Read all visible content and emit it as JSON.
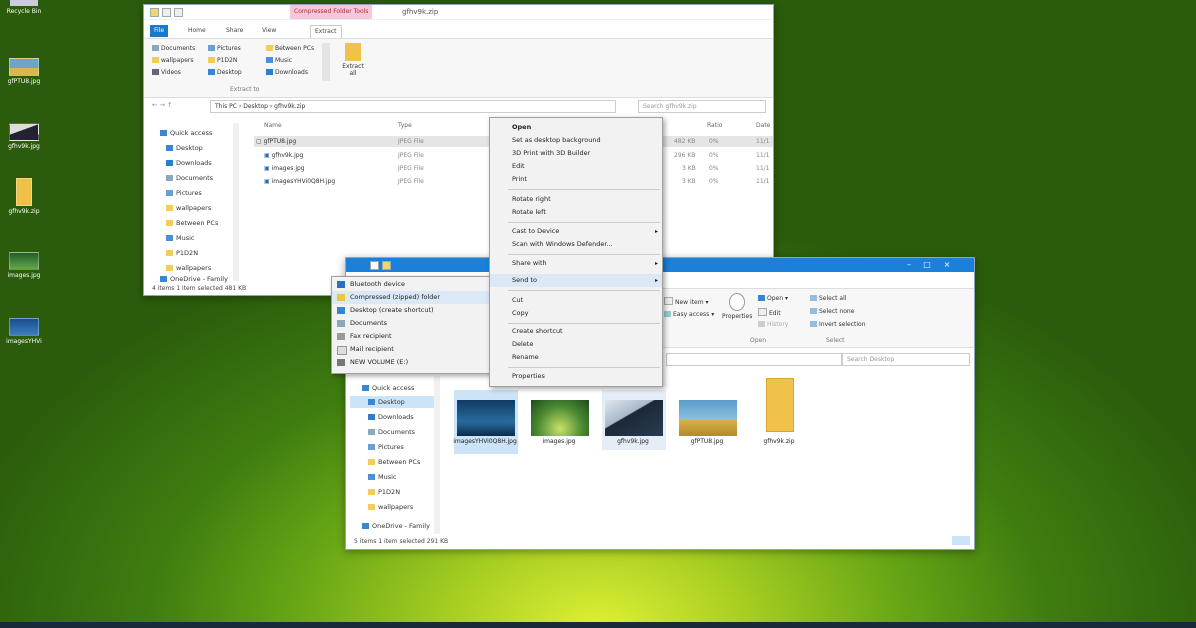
{
  "desktop": {
    "icons": [
      {
        "label": "Recycle Bin"
      },
      {
        "label": "gfPTU8.jpg"
      },
      {
        "label": "gfhv9k.jpg"
      },
      {
        "label": "gfhv9k.zip"
      },
      {
        "label": "images.jpg"
      },
      {
        "label": "imagesYHVi"
      }
    ]
  },
  "back_window": {
    "contextual_tab": "Compressed Folder Tools",
    "title": "gfhv9k.zip",
    "tabs": [
      "File",
      "Home",
      "Share",
      "View",
      "Extract"
    ],
    "ribbon": {
      "col1": [
        "Documents",
        "wallpapers",
        "Videos"
      ],
      "col2": [
        "Pictures",
        "P1D2N",
        "Desktop"
      ],
      "col3": [
        "Between PCs",
        "Music",
        "Downloads"
      ],
      "extract_all": "Extract all",
      "group_label": "Extract to"
    },
    "breadcrumb": [
      "This PC",
      "Desktop",
      "gfhv9k.zip"
    ],
    "search_placeholder": "Search gfhv9k.zip",
    "nav": [
      "Quick access",
      "Desktop",
      "Downloads",
      "Documents",
      "Pictures",
      "wallpapers",
      "Between PCs",
      "Music",
      "P1D2N",
      "wallpapers",
      "OneDrive - Family"
    ],
    "columns": [
      "Name",
      "Type",
      "Ratio",
      "Date"
    ],
    "files": [
      {
        "name": "gfPTU8.jpg",
        "type": "JPEG File",
        "size": "482 KB",
        "ratio": "0%",
        "date": "11/1"
      },
      {
        "name": "gfhv9k.jpg",
        "type": "JPEG File",
        "size": "296 KB",
        "ratio": "0%",
        "date": "11/1"
      },
      {
        "name": "images.jpg",
        "type": "JPEG File",
        "size": "3 KB",
        "ratio": "0%",
        "date": "11/1"
      },
      {
        "name": "imagesYHVi0Q8H.jpg",
        "type": "JPEG File",
        "size": "3 KB",
        "ratio": "0%",
        "date": "11/1"
      }
    ],
    "status": "4 items    1 item selected  481 KB"
  },
  "front_window": {
    "ribbon": {
      "new_item": "New item",
      "easy_access": "Easy access",
      "properties": "Properties",
      "open": "Open",
      "edit": "Edit",
      "history": "History",
      "select_all": "Select all",
      "select_none": "Select none",
      "invert_selection": "Invert selection",
      "groups": [
        "Open",
        "Select"
      ]
    },
    "search_placeholder": "Search Desktop",
    "nav": [
      "Quick access",
      "Desktop",
      "Downloads",
      "Documents",
      "Pictures",
      "Between PCs",
      "Music",
      "P1D2N",
      "wallpapers",
      "OneDrive - Family"
    ],
    "thumbs": [
      {
        "label": "imagesYHVi0Q8H.jpg"
      },
      {
        "label": "images.jpg"
      },
      {
        "label": "gfhv9k.jpg"
      },
      {
        "label": "gfPTU8.jpg"
      },
      {
        "label": "gfhv9k.zip"
      }
    ],
    "status": "5 items    1 item selected  291 KB"
  },
  "context_menu": {
    "items": [
      "Open",
      "Set as desktop background",
      "3D Print with 3D Builder",
      "Edit",
      "Print",
      "Rotate right",
      "Rotate left",
      "Cast to Device",
      "Scan with Windows Defender...",
      "Share with",
      "Send to",
      "Cut",
      "Copy",
      "Create shortcut",
      "Delete",
      "Rename",
      "Properties"
    ]
  },
  "sendto_menu": {
    "items": [
      "Bluetooth device",
      "Compressed (zipped) folder",
      "Desktop (create shortcut)",
      "Documents",
      "Fax recipient",
      "Mail recipient",
      "NEW VOLUME (E:)"
    ]
  },
  "colors": {
    "accent": "#1a80d9",
    "highlight": "#dbe8f5",
    "contextual_tab": "#f5c6dc"
  }
}
